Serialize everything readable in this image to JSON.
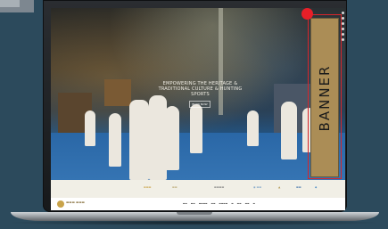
{
  "banner": {
    "label": "BANNER",
    "colors": {
      "fill": "#ab8d56",
      "frame": "#d8252b",
      "marker": "#e81f28"
    }
  },
  "hero": {
    "headline": "EMPOWERING THE HERITAGE & TRADITIONAL CULTURE & HUNTING SPORTS",
    "button_label": "BOOK NOW"
  },
  "side_nav_dots": [
    1,
    2,
    3,
    4,
    5,
    6
  ],
  "logo_strip": [
    "sponsor-logo-1",
    "sponsor-logo-2",
    "sponsor-logo-3",
    "sponsor-logo-4",
    "sponsor-logo-5",
    "sponsor-logo-6",
    "sponsor-logo-7"
  ],
  "navbar": {
    "logo_icon": "falcon-emblem-icon"
  }
}
